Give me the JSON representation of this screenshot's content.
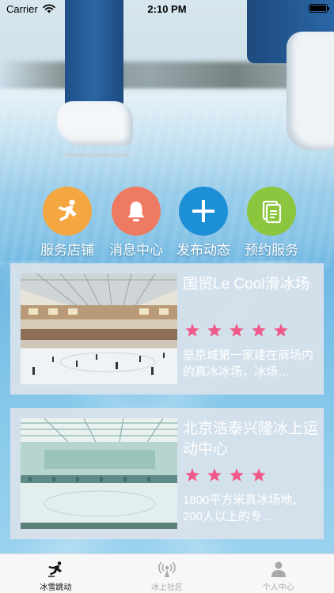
{
  "status_bar": {
    "carrier": "Carrier",
    "time": "2:10 PM",
    "icons": [
      "wifi-icon",
      "battery-icon"
    ]
  },
  "quick_actions": [
    {
      "label": "服务店铺",
      "icon": "skater-icon",
      "color": "#f4a641"
    },
    {
      "label": "消息中心",
      "icon": "bell-icon",
      "color": "#ef7a63"
    },
    {
      "label": "发布动态",
      "icon": "plus-icon",
      "color": "#1c8fd6"
    },
    {
      "label": "预约服务",
      "icon": "document-icon",
      "color": "#8cc63e"
    }
  ],
  "venues": [
    {
      "title": "国贸Le Cool滑冰场",
      "rating": 5,
      "description": "是京城第一家建在商场内的真冰冰场，冰场…"
    },
    {
      "title": "北京浩泰兴隆冰上运动中心",
      "rating": 4,
      "description": "1800平方米真冰场地、200人以上的专…"
    }
  ],
  "tab_bar": {
    "tabs": [
      {
        "label": "冰雪跳动",
        "icon": "skater-icon",
        "active": true
      },
      {
        "label": "冰上社区",
        "icon": "broadcast-icon",
        "active": false
      },
      {
        "label": "个人中心",
        "icon": "person-icon",
        "active": false
      }
    ]
  },
  "colors": {
    "star_fill": "#f05a8a",
    "tab_active": "#111111",
    "tab_inactive": "#a9a9a9"
  }
}
